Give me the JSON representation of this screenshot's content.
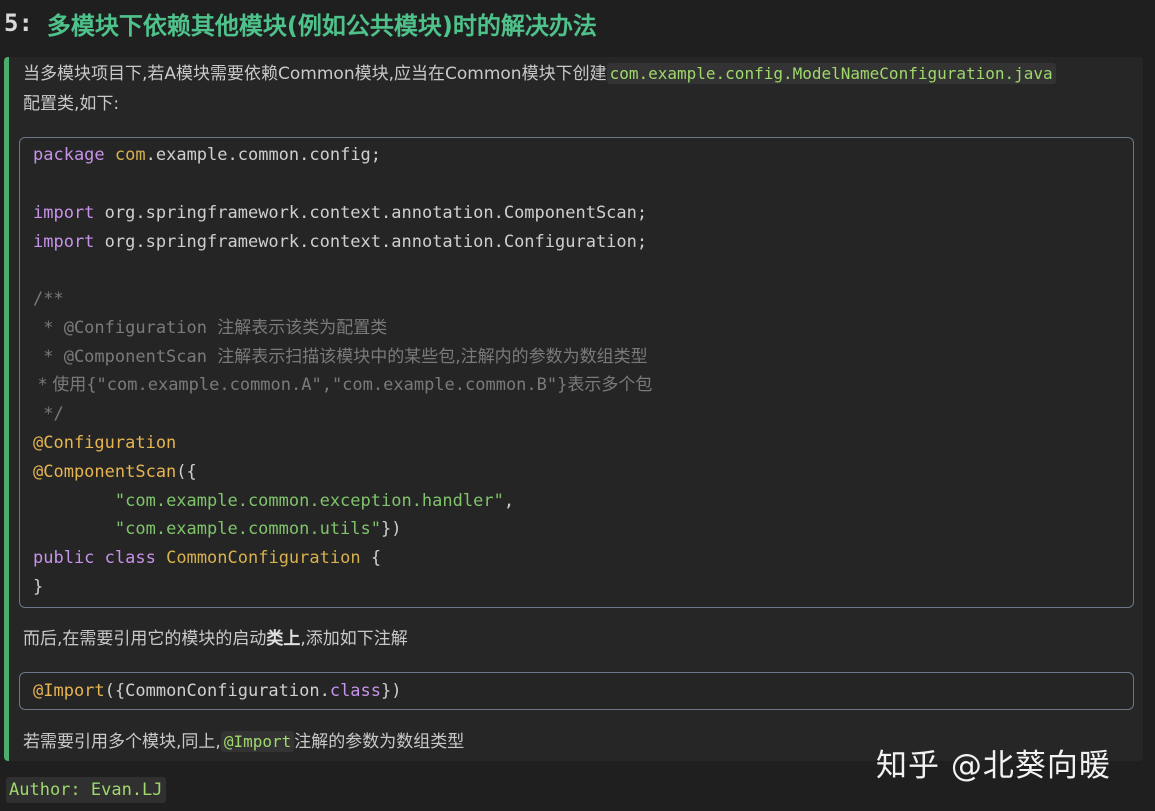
{
  "heading": {
    "number": "5:",
    "title": "多模块下依赖其他模块(例如公共模块)时的解决办法"
  },
  "intro": {
    "text_before": "当多模块项目下,若A模块需要依赖Common模块,应当在Common模块下创建",
    "inline_code": "com.example.config.ModelNameConfiguration.java",
    "text_after": "配置类,如下:"
  },
  "code1": {
    "pkg_kw": "package",
    "pkg_root": "com",
    "pkg_rest": ".example.common.config;",
    "import_kw": "import",
    "import1": "org.springframework.context.annotation.ComponentScan;",
    "import2": "org.springframework.context.annotation.Configuration;",
    "c_open": "/**",
    "c1_tag": " * @Configuration ",
    "c1_text": "注解表示该类为配置类",
    "c2_tag": " * @ComponentScan ",
    "c2_text": "注解表示扫描该模块中的某些包,注解内的参数为数组类型",
    "c3_pre": " * 使用",
    "c3_mid": "{\"com.example.common.A\",\"com.example.common.B\"}",
    "c3_post": "表示多个包",
    "c_close": " */",
    "ann1": "@Configuration",
    "ann2": "@ComponentScan",
    "ann2_paren": "({",
    "str1": "\"com.example.common.exception.handler\"",
    "str1_comma": ",",
    "str2": "\"com.example.common.utils\"",
    "str2_close": "})",
    "public_kw": "public",
    "class_kw": "class",
    "class_name": "CommonConfiguration",
    "brace_open": " {",
    "brace_close": "}"
  },
  "then": {
    "text_before": "而后,在需要引用它的模块的启动",
    "bold": "类上",
    "text_after": ",添加如下注解"
  },
  "code2": {
    "ann": "@Import",
    "paren_open": "({CommonConfiguration.",
    "class_kw": "class",
    "paren_close": "})"
  },
  "multi": {
    "text_before": "若需要引用多个模块,同上,",
    "inline_code": "@Import",
    "text_after": "注解的参数为数组类型"
  },
  "author": "Author: Evan.LJ",
  "watermark": "知乎 @北葵向暖"
}
